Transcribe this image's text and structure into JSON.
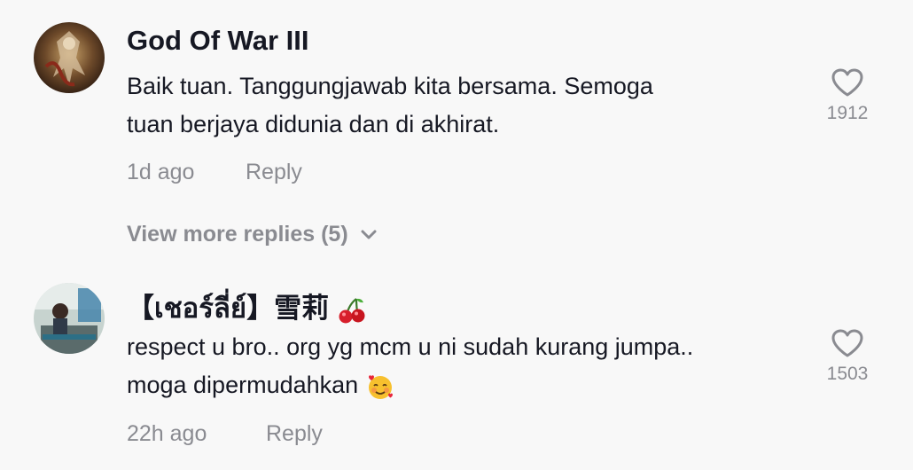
{
  "comments": [
    {
      "username": "God Of War III",
      "line1": "Baik tuan. Tanggungjawab kita bersama. Semoga",
      "line2": "tuan berjaya didunia dan di akhirat.",
      "time": "1d ago",
      "reply_label": "Reply",
      "likes": "1912"
    },
    {
      "username": "【เชอร์ลี่ย์】雪莉",
      "line1": "respect u bro.. org yg mcm u ni sudah kurang jumpa..",
      "line2": "moga dipermudahkan",
      "time": "22h ago",
      "reply_label": "Reply",
      "likes": "1503"
    }
  ],
  "view_more": {
    "label": "View more replies (5)"
  },
  "icons": {
    "heart": "heart-outline-icon",
    "chevron": "chevron-down-icon",
    "cherry": "cherry-emoji",
    "smiling_hearts": "smiling-face-with-hearts-emoji"
  },
  "colors": {
    "primary_text": "#161823",
    "secondary_text": "#8a8b91",
    "background": "#f8f8f8"
  }
}
